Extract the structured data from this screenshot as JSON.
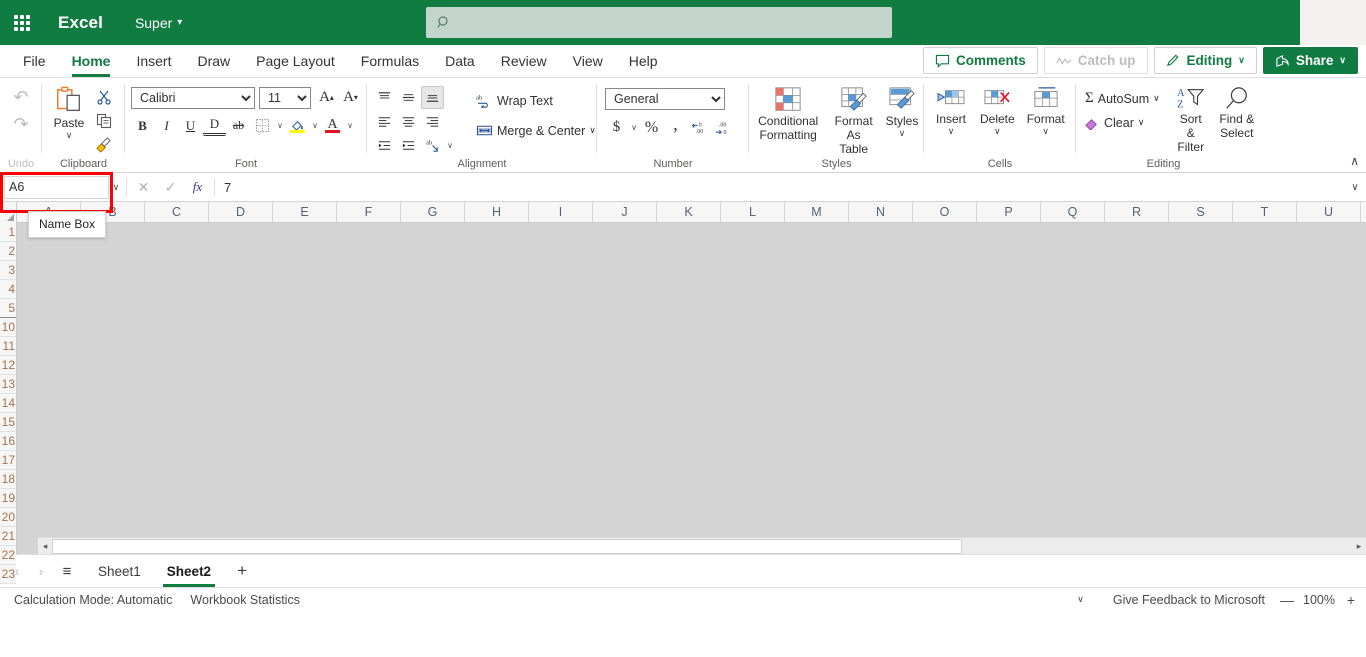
{
  "titlebar": {
    "waffle_icon": "app-launcher-waffle-icon",
    "app_name": "Excel",
    "document_name": "Super",
    "search": {
      "placeholder": "",
      "value": "",
      "icon": "search-icon"
    }
  },
  "tabs": [
    {
      "label": "File",
      "active": false
    },
    {
      "label": "Home",
      "active": true
    },
    {
      "label": "Insert",
      "active": false
    },
    {
      "label": "Draw",
      "active": false
    },
    {
      "label": "Page Layout",
      "active": false
    },
    {
      "label": "Formulas",
      "active": false
    },
    {
      "label": "Data",
      "active": false
    },
    {
      "label": "Review",
      "active": false
    },
    {
      "label": "View",
      "active": false
    },
    {
      "label": "Help",
      "active": false
    }
  ],
  "tab_actions": {
    "comments": {
      "label": "Comments",
      "icon": "comment-bubble-icon",
      "disabled": false
    },
    "catch_up": {
      "label": "Catch up",
      "icon": "catch-up-wave-icon",
      "disabled": true
    },
    "editing": {
      "label": "Editing",
      "icon": "pencil-icon",
      "chevron": "∨"
    },
    "share": {
      "label": "Share",
      "icon": "share-arrow-icon",
      "chevron": "∨"
    }
  },
  "ribbon": {
    "undo_group": {
      "label": "Undo",
      "undo": {
        "icon": "undo-arrow-icon"
      },
      "redo": {
        "icon": "redo-arrow-icon"
      }
    },
    "clipboard": {
      "label": "Clipboard",
      "paste": {
        "label": "Paste",
        "icon": "clipboard-paste-icon",
        "chevron": "∨"
      },
      "cut": {
        "icon": "scissors-icon"
      },
      "copy": {
        "icon": "copy-pages-icon"
      },
      "format_painter": {
        "icon": "format-painter-brush-icon"
      }
    },
    "font": {
      "label": "Font",
      "font_name": "Calibri",
      "font_size": "11",
      "grow_font": {
        "icon": "grow-font-icon",
        "glyph": "A"
      },
      "shrink_font": {
        "icon": "shrink-font-icon",
        "glyph": "A"
      },
      "bold": {
        "glyph": "B",
        "icon": "bold-icon"
      },
      "italic": {
        "glyph": "I",
        "icon": "italic-icon"
      },
      "underline": {
        "glyph": "U",
        "icon": "underline-icon"
      },
      "double_underline": {
        "glyph": "D",
        "icon": "double-underline-icon"
      },
      "strikethrough": {
        "glyph": "ab",
        "icon": "strikethrough-icon"
      },
      "borders": {
        "icon": "borders-icon",
        "chevron": "∨"
      },
      "fill_color": {
        "icon": "fill-color-icon",
        "color": "#ffff00",
        "chevron": "∨"
      },
      "font_color": {
        "icon": "font-color-icon",
        "glyph": "A",
        "color": "#e81123",
        "chevron": "∨"
      }
    },
    "alignment": {
      "label": "Alignment",
      "top_align": {
        "icon": "align-top-icon"
      },
      "middle_align": {
        "icon": "align-middle-icon"
      },
      "bottom_align": {
        "icon": "align-bottom-icon",
        "selected": true
      },
      "align_left": {
        "icon": "align-left-icon"
      },
      "align_center": {
        "icon": "align-center-icon"
      },
      "align_right": {
        "icon": "align-right-icon"
      },
      "decrease_indent": {
        "icon": "decrease-indent-icon"
      },
      "increase_indent": {
        "icon": "increase-indent-icon"
      },
      "orientation": {
        "icon": "text-orientation-icon",
        "chevron": "∨"
      },
      "wrap_text": {
        "label": "Wrap Text",
        "icon": "wrap-text-icon"
      },
      "merge_center": {
        "label": "Merge & Center",
        "icon": "merge-cells-icon",
        "chevron": "∨"
      }
    },
    "number": {
      "label": "Number",
      "format": "General",
      "currency": {
        "glyph": "$",
        "icon": "currency-icon",
        "chevron": "∨"
      },
      "percent": {
        "glyph": "%",
        "icon": "percent-style-icon"
      },
      "comma": {
        "glyph": " ",
        "icon": "comma-style-icon"
      },
      "decrease_decimal": {
        "icon": "decrease-decimal-icon"
      },
      "increase_decimal": {
        "icon": "increase-decimal-icon"
      }
    },
    "styles": {
      "label": "Styles",
      "conditional_formatting": {
        "label": "Conditional Formatting",
        "icon": "conditional-formatting-icon",
        "chevron": "∨"
      },
      "format_as_table": {
        "label": "Format As Table",
        "icon": "format-as-table-icon",
        "chevron": "∨"
      },
      "cell_styles": {
        "label": "Styles",
        "icon": "cell-styles-icon",
        "chevron": "∨"
      }
    },
    "cells": {
      "label": "Cells",
      "insert": {
        "label": "Insert",
        "icon": "insert-cells-icon",
        "chevron": "∨"
      },
      "delete": {
        "label": "Delete",
        "icon": "delete-cells-icon",
        "chevron": "∨"
      },
      "format": {
        "label": "Format",
        "icon": "format-cells-icon",
        "chevron": "∨"
      }
    },
    "editing": {
      "label": "Editing",
      "autosum": {
        "label": "AutoSum",
        "icon": "autosum-sigma-icon",
        "glyph": "Σ",
        "chevron": "∨"
      },
      "clear": {
        "label": "Clear",
        "icon": "clear-eraser-icon",
        "chevron": "∨"
      },
      "sort_filter": {
        "label": "Sort & Filter",
        "icon": "sort-filter-icon",
        "chevron": "∨"
      },
      "find_select": {
        "label": "Find & Select",
        "icon": "find-magnifier-icon",
        "chevron": "∨"
      }
    },
    "collapse_ribbon": {
      "icon": "chevron-up-icon",
      "glyph": "∧"
    }
  },
  "formula_bar": {
    "name_box": {
      "value": "A6",
      "chevron": "∨",
      "highlighted": true,
      "highlight_color": "#fe0000"
    },
    "cancel": {
      "icon": "cancel-x-icon",
      "glyph": "✕"
    },
    "enter": {
      "icon": "confirm-check-icon",
      "glyph": "✓"
    },
    "insert_function": {
      "icon": "insert-function-icon",
      "glyph": "fx"
    },
    "formula_value": "7",
    "expand": {
      "icon": "chevron-down-icon",
      "glyph": "∨"
    }
  },
  "tooltip": {
    "text": "Name Box"
  },
  "grid": {
    "columns": [
      "A",
      "B",
      "C",
      "D",
      "E",
      "F",
      "G",
      "H",
      "I",
      "J",
      "K",
      "L",
      "M",
      "N",
      "O",
      "P",
      "Q",
      "R",
      "S",
      "T",
      "U"
    ],
    "rows": [
      {
        "label": "1",
        "thick": false
      },
      {
        "label": "2",
        "thick": false
      },
      {
        "label": "3",
        "thick": false
      },
      {
        "label": "4",
        "thick": false
      },
      {
        "label": "5",
        "thick": true
      },
      {
        "label": "10",
        "thick": false
      },
      {
        "label": "11",
        "thick": false
      },
      {
        "label": "12",
        "thick": false
      },
      {
        "label": "13",
        "thick": false
      },
      {
        "label": "14",
        "thick": false
      },
      {
        "label": "15",
        "thick": false
      },
      {
        "label": "16",
        "thick": false
      },
      {
        "label": "17",
        "thick": false
      },
      {
        "label": "18",
        "thick": false
      },
      {
        "label": "19",
        "thick": false
      },
      {
        "label": "20",
        "thick": false
      },
      {
        "label": "21",
        "thick": false
      },
      {
        "label": "22",
        "thick": false
      },
      {
        "label": "23",
        "thick": false
      }
    ],
    "select_all_corner": "select-all-icon",
    "dimmed": true,
    "hscroll": {
      "left_arrow": "◂",
      "right_arrow": "▸",
      "thumb_percent": 68.5
    }
  },
  "sheet_bar": {
    "prev": {
      "icon": "chevron-left-icon",
      "glyph": "‹",
      "disabled": true
    },
    "next": {
      "icon": "chevron-right-icon",
      "glyph": "›",
      "disabled": true
    },
    "all_sheets": {
      "icon": "hamburger-menu-icon",
      "glyph": "≡"
    },
    "sheets": [
      {
        "label": "Sheet1",
        "active": false
      },
      {
        "label": "Sheet2",
        "active": true
      }
    ],
    "add_sheet": {
      "icon": "plus-icon",
      "glyph": "+"
    }
  },
  "status_bar": {
    "calculation_mode": "Calculation Mode: Automatic",
    "workbook_statistics": "Workbook Statistics",
    "more": {
      "icon": "chevron-down-icon",
      "glyph": "∨"
    },
    "feedback": "Give Feedback to Microsoft",
    "zoom_out": {
      "icon": "minus-icon",
      "glyph": "—"
    },
    "zoom_level": "100%",
    "zoom_in": {
      "icon": "plus-icon",
      "glyph": "+"
    }
  },
  "colors": {
    "brand_green": "#107c41",
    "search_bg": "#c3d4ca",
    "highlight_red": "#fe0000",
    "grid_dim": "#d4d4d4",
    "row_header_text": "#a6724a"
  }
}
